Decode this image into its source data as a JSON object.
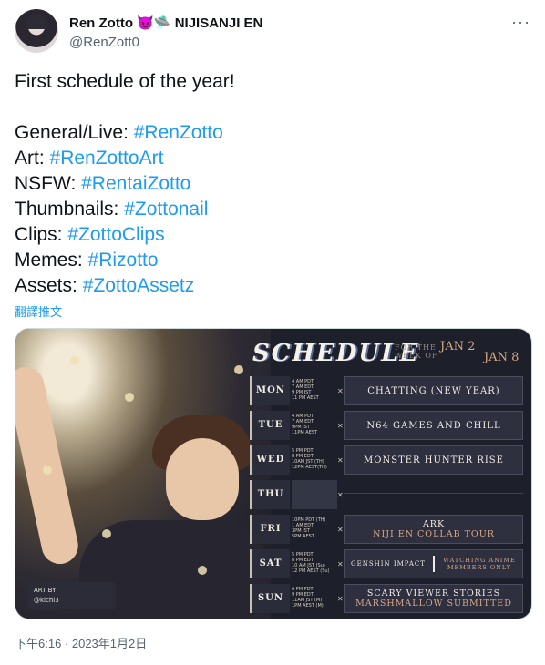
{
  "header": {
    "display_name": "Ren Zotto",
    "emoji": "😈🛸",
    "affiliation": "NIJISANJI EN",
    "handle": "@RenZott0",
    "more": "···"
  },
  "tweet": {
    "intro": "First schedule of the year!",
    "lines": [
      {
        "label": "General/Live: ",
        "tag": "#RenZotto"
      },
      {
        "label": "Art: ",
        "tag": "#RenZottoArt"
      },
      {
        "label": "NSFW: ",
        "tag": "#RentaiZotto"
      },
      {
        "label": "Thumbnails: ",
        "tag": "#Zottonail"
      },
      {
        "label": "Clips: ",
        "tag": "#ZottoClips"
      },
      {
        "label": "Memes: ",
        "tag": "#Rizotto"
      },
      {
        "label": "Assets: ",
        "tag": "#ZottoAssetz"
      }
    ],
    "translate": "翻譯推文",
    "timestamp": "下午6:16 · 2023年1月2日"
  },
  "schedule": {
    "title": "SCHEDULE",
    "week_label_1": "FOR THE",
    "week_label_2": "WEEK OF",
    "date_start": "JAN 2",
    "date_end": "JAN 8",
    "art_by": "ART BY",
    "artist": "@kichi3",
    "rows": [
      {
        "day": "MON",
        "times": [
          "4 AM PDT",
          "7 AM EDT",
          "9 PM JST",
          "11 PM AEST"
        ],
        "event": "CHATTING (NEW YEAR)",
        "sub": ""
      },
      {
        "day": "TUE",
        "times": [
          "4 AM PDT",
          "7 AM EDT",
          "9PM JST",
          "11PM AEST"
        ],
        "event": "N64 GAMES AND CHILL",
        "sub": ""
      },
      {
        "day": "WED",
        "times": [
          "5 PM PDT",
          "8 PM EDT",
          "10AM JST (TH)",
          "12PM AEST(TH)"
        ],
        "event": "MONSTER HUNTER RISE",
        "sub": ""
      },
      {
        "day": "THU",
        "times": [],
        "event": "",
        "sub": ""
      },
      {
        "day": "FRI",
        "times": [
          "10PM PDT (TH)",
          "1 AM EDT",
          "3PM JST",
          "5PM AEST"
        ],
        "event": "ARK",
        "sub": "NIJI EN COLLAB TOUR"
      },
      {
        "day": "SAT",
        "times": [
          "5 PM PDT",
          "8 PM EDT",
          "10 AM JST (Su)",
          "12 PM AEST (Su)"
        ],
        "event": "GENSHIN IMPACT",
        "sub": "WATCHING ANIME MEMBERS ONLY"
      },
      {
        "day": "SUN",
        "times": [
          "6 PM PDT",
          "9 PM EDT",
          "11AM JST (M)",
          "1PM AEST (M)"
        ],
        "event": "SCARY VIEWER STORIES",
        "sub": "MARSHMALLOW SUBMITTED"
      }
    ]
  }
}
